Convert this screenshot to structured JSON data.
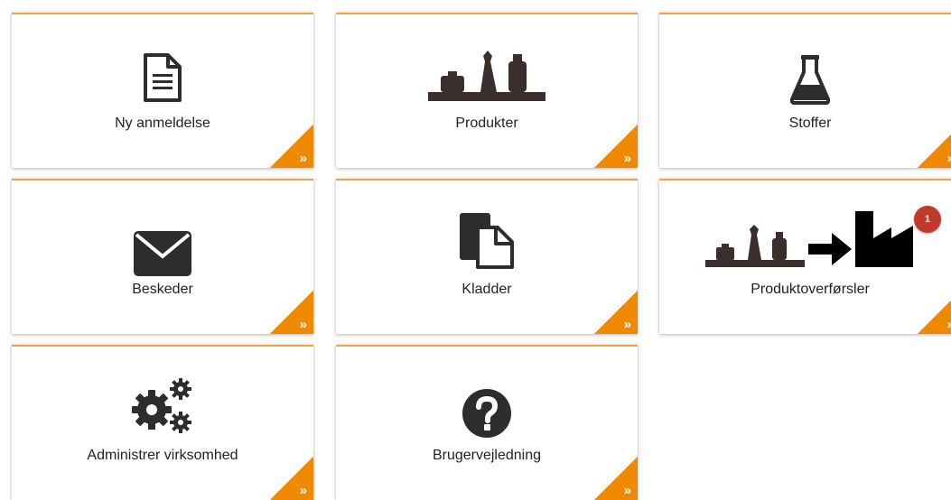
{
  "tiles": [
    {
      "label": "Ny anmeldelse",
      "icon": "document-icon"
    },
    {
      "label": "Produkter",
      "icon": "products-shelf-icon"
    },
    {
      "label": "Stoffer",
      "icon": "flask-icon"
    },
    {
      "label": "Beskeder",
      "icon": "envelope-icon"
    },
    {
      "label": "Kladder",
      "icon": "drafts-icon"
    },
    {
      "label": "Produktoverførsler",
      "icon": "product-transfer-icon",
      "badge": "1"
    },
    {
      "label": "Administrer virksomhed",
      "icon": "gears-icon"
    },
    {
      "label": "Brugervejledning",
      "icon": "question-circle-icon"
    }
  ],
  "corner_glyph": "»",
  "colors": {
    "accent": "#ef8a00",
    "top_border": "#f0a046",
    "icon": "#3a2f2c",
    "badge": "#c0392b"
  }
}
